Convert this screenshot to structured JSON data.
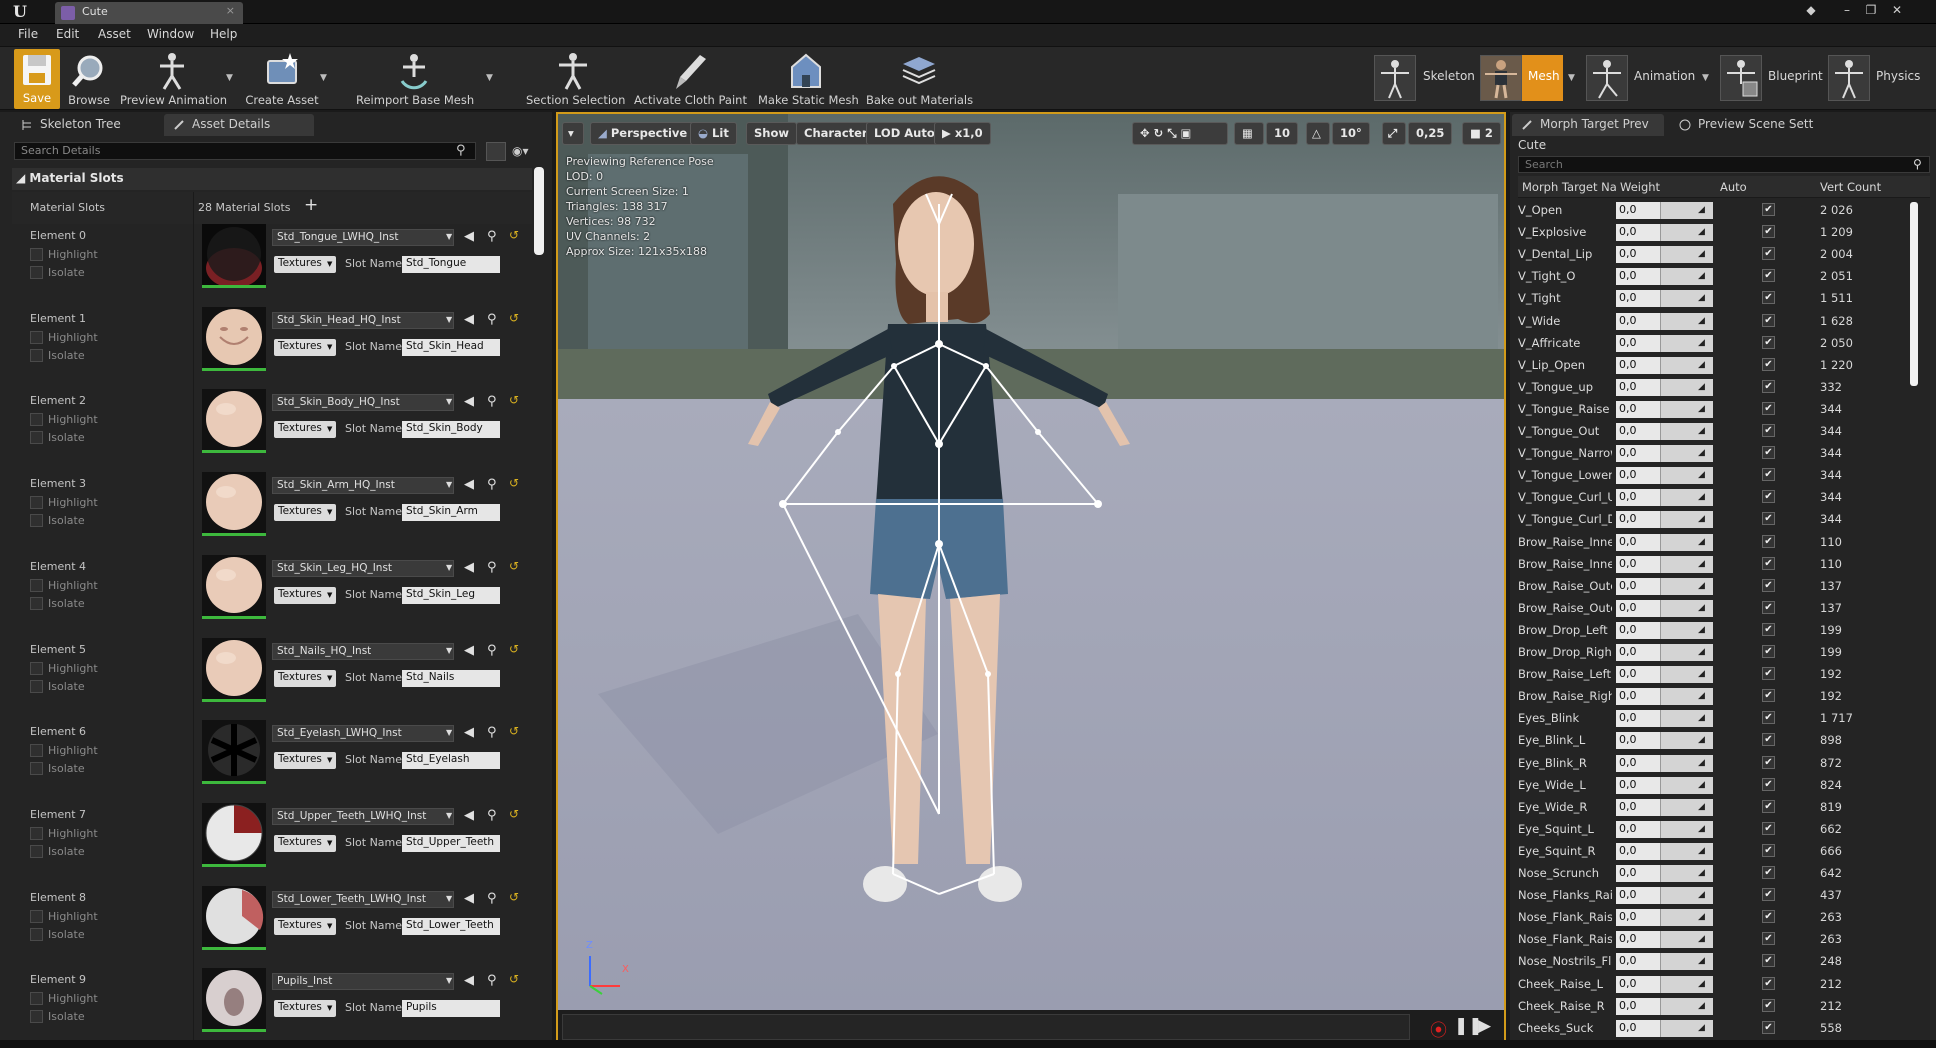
{
  "app": {
    "tab_title": "Cute",
    "tab_close": "×"
  },
  "menu": [
    "File",
    "Edit",
    "Asset",
    "Window",
    "Help"
  ],
  "toolbar": {
    "buttons": [
      "Save",
      "Browse",
      "Preview Animation",
      "Create Asset",
      "Reimport Base Mesh",
      "Section Selection",
      "Activate Cloth Paint",
      "Make Static Mesh",
      "Bake out Materials"
    ],
    "modes": [
      "Skeleton",
      "Mesh",
      "Animation",
      "Blueprint",
      "Physics"
    ]
  },
  "left_panel": {
    "tabs": [
      "Skeleton Tree",
      "Asset Details"
    ],
    "search_placeholder": "Search Details",
    "section_title": "Material Slots",
    "row_label": "Material Slots",
    "slots_count": "28 Material Slots",
    "add_icon": "+",
    "highlight_label": "Highlight",
    "isolate_label": "Isolate",
    "textures_label": "Textures",
    "slot_name_label": "Slot Name",
    "elements": [
      {
        "name": "Element 0",
        "material": "Std_Tongue_LWHQ_Inst",
        "slot": "Std_Tongue",
        "thumb": "tongue"
      },
      {
        "name": "Element 1",
        "material": "Std_Skin_Head_HQ_Inst",
        "slot": "Std_Skin_Head",
        "thumb": "head"
      },
      {
        "name": "Element 2",
        "material": "Std_Skin_Body_HQ_Inst",
        "slot": "Std_Skin_Body",
        "thumb": "skin"
      },
      {
        "name": "Element 3",
        "material": "Std_Skin_Arm_HQ_Inst",
        "slot": "Std_Skin_Arm",
        "thumb": "skin"
      },
      {
        "name": "Element 4",
        "material": "Std_Skin_Leg_HQ_Inst",
        "slot": "Std_Skin_Leg",
        "thumb": "skin"
      },
      {
        "name": "Element 5",
        "material": "Std_Nails_HQ_Inst",
        "slot": "Std_Nails",
        "thumb": "skin"
      },
      {
        "name": "Element 6",
        "material": "Std_Eyelash_LWHQ_Inst",
        "slot": "Std_Eyelash",
        "thumb": "eyelash"
      },
      {
        "name": "Element 7",
        "material": "Std_Upper_Teeth_LWHQ_Inst",
        "slot": "Std_Upper_Teeth",
        "thumb": "teeth"
      },
      {
        "name": "Element 8",
        "material": "Std_Lower_Teeth_LWHQ_Inst",
        "slot": "Std_Lower_Teeth",
        "thumb": "teeth2"
      },
      {
        "name": "Element 9",
        "material": "Pupils_Inst",
        "slot": "Pupils",
        "thumb": "pupils"
      }
    ]
  },
  "viewport": {
    "buttons": {
      "perspective": "Perspective",
      "lit": "Lit",
      "show": "Show",
      "character": "Character",
      "lod": "LOD Auto",
      "speed": "x1,0",
      "grid": "10",
      "angle": "10°",
      "scale": "0,25",
      "camera": "2"
    },
    "stats": [
      "Previewing Reference Pose",
      "LOD: 0",
      "Current Screen Size: 1",
      "Triangles: 138 317",
      "Vertices: 98 732",
      "UV Channels: 2",
      "Approx Size: 121x35x188"
    ],
    "axis_z": "Z",
    "axis_x": "X"
  },
  "right_panel": {
    "tabs": [
      "Morph Target Prev",
      "Preview Scene Sett"
    ],
    "title": "Cute",
    "search_placeholder": "Search",
    "columns": [
      "Morph Target Na",
      "Weight",
      "Auto",
      "Vert Count"
    ],
    "check_glyph": "✔",
    "morphs": [
      {
        "name": "V_Open",
        "weight": "0,0",
        "count": "2 026"
      },
      {
        "name": "V_Explosive",
        "weight": "0,0",
        "count": "1 209"
      },
      {
        "name": "V_Dental_Lip",
        "weight": "0,0",
        "count": "2 004"
      },
      {
        "name": "V_Tight_O",
        "weight": "0,0",
        "count": "2 051"
      },
      {
        "name": "V_Tight",
        "weight": "0,0",
        "count": "1 511"
      },
      {
        "name": "V_Wide",
        "weight": "0,0",
        "count": "1 628"
      },
      {
        "name": "V_Affricate",
        "weight": "0,0",
        "count": "2 050"
      },
      {
        "name": "V_Lip_Open",
        "weight": "0,0",
        "count": "1 220"
      },
      {
        "name": "V_Tongue_up",
        "weight": "0,0",
        "count": "332"
      },
      {
        "name": "V_Tongue_Raise",
        "weight": "0,0",
        "count": "344"
      },
      {
        "name": "V_Tongue_Out",
        "weight": "0,0",
        "count": "344"
      },
      {
        "name": "V_Tongue_Narrow",
        "weight": "0,0",
        "count": "344"
      },
      {
        "name": "V_Tongue_Lower",
        "weight": "0,0",
        "count": "344"
      },
      {
        "name": "V_Tongue_Curl_U",
        "weight": "0,0",
        "count": "344"
      },
      {
        "name": "V_Tongue_Curl_D",
        "weight": "0,0",
        "count": "344"
      },
      {
        "name": "Brow_Raise_Inner",
        "weight": "0,0",
        "count": "110"
      },
      {
        "name": "Brow_Raise_Inner",
        "weight": "0,0",
        "count": "110"
      },
      {
        "name": "Brow_Raise_Outer",
        "weight": "0,0",
        "count": "137"
      },
      {
        "name": "Brow_Raise_Outer",
        "weight": "0,0",
        "count": "137"
      },
      {
        "name": "Brow_Drop_Left",
        "weight": "0,0",
        "count": "199"
      },
      {
        "name": "Brow_Drop_Right",
        "weight": "0,0",
        "count": "199"
      },
      {
        "name": "Brow_Raise_Left",
        "weight": "0,0",
        "count": "192"
      },
      {
        "name": "Brow_Raise_Right",
        "weight": "0,0",
        "count": "192"
      },
      {
        "name": "Eyes_Blink",
        "weight": "0,0",
        "count": "1 717"
      },
      {
        "name": "Eye_Blink_L",
        "weight": "0,0",
        "count": "898"
      },
      {
        "name": "Eye_Blink_R",
        "weight": "0,0",
        "count": "872"
      },
      {
        "name": "Eye_Wide_L",
        "weight": "0,0",
        "count": "824"
      },
      {
        "name": "Eye_Wide_R",
        "weight": "0,0",
        "count": "819"
      },
      {
        "name": "Eye_Squint_L",
        "weight": "0,0",
        "count": "662"
      },
      {
        "name": "Eye_Squint_R",
        "weight": "0,0",
        "count": "666"
      },
      {
        "name": "Nose_Scrunch",
        "weight": "0,0",
        "count": "642"
      },
      {
        "name": "Nose_Flanks_Raise",
        "weight": "0,0",
        "count": "437"
      },
      {
        "name": "Nose_Flank_Raise",
        "weight": "0,0",
        "count": "263"
      },
      {
        "name": "Nose_Flank_Raise",
        "weight": "0,0",
        "count": "263"
      },
      {
        "name": "Nose_Nostrils_Flare",
        "weight": "0,0",
        "count": "248"
      },
      {
        "name": "Cheek_Raise_L",
        "weight": "0,0",
        "count": "212"
      },
      {
        "name": "Cheek_Raise_R",
        "weight": "0,0",
        "count": "212"
      },
      {
        "name": "Cheeks_Suck",
        "weight": "0,0",
        "count": "558"
      }
    ]
  },
  "colors": {
    "accent": "#e2901a",
    "viewport_border": "#d29b1a",
    "panel_bg": "#242424",
    "thumb_ok": "#3db83d"
  },
  "icons": [
    "ue-logo-icon",
    "save-icon",
    "browse-icon",
    "preview-animation-icon",
    "create-asset-icon",
    "reimport-icon",
    "section-selection-icon",
    "cloth-paint-icon",
    "static-mesh-icon",
    "bake-materials-icon",
    "skeleton-mode-icon",
    "mesh-mode-icon",
    "animation-mode-icon",
    "blueprint-mode-icon",
    "physics-mode-icon",
    "search-icon",
    "eye-icon",
    "record-icon",
    "pause-icon",
    "play-icon"
  ]
}
